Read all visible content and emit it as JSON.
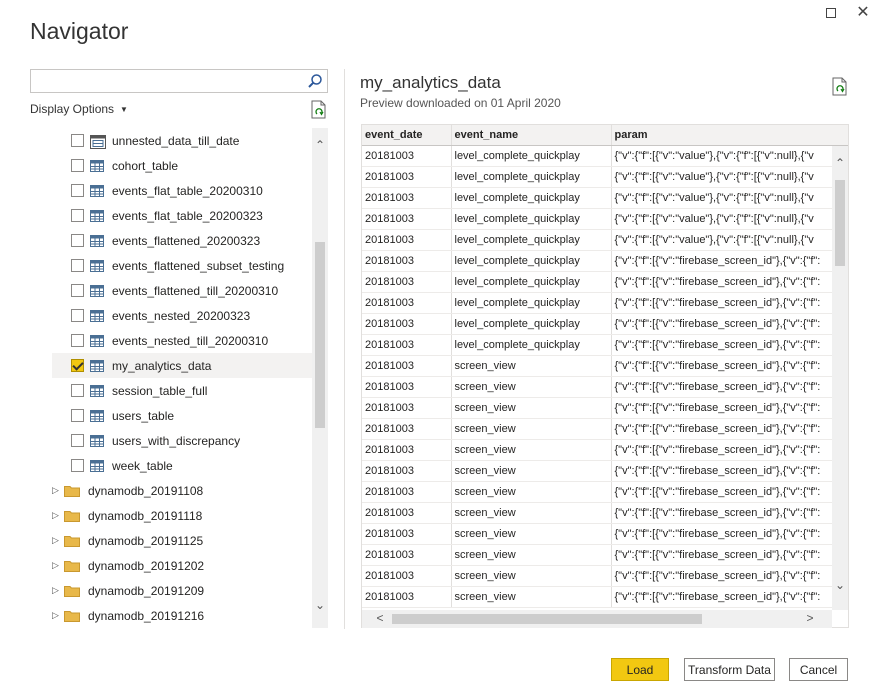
{
  "window": {
    "title": "Navigator"
  },
  "navigator": {
    "search": {
      "value": "",
      "placeholder": ""
    },
    "display_options_label": "Display Options",
    "items": [
      {
        "type": "view",
        "label": "unnested_data_till_date",
        "checked": false
      },
      {
        "type": "table",
        "label": "cohort_table",
        "checked": false
      },
      {
        "type": "table",
        "label": "events_flat_table_20200310",
        "checked": false
      },
      {
        "type": "table",
        "label": "events_flat_table_20200323",
        "checked": false
      },
      {
        "type": "table",
        "label": "events_flattened_20200323",
        "checked": false
      },
      {
        "type": "table",
        "label": "events_flattened_subset_testing",
        "checked": false
      },
      {
        "type": "table",
        "label": "events_flattened_till_20200310",
        "checked": false
      },
      {
        "type": "table",
        "label": "events_nested_20200323",
        "checked": false
      },
      {
        "type": "table",
        "label": "events_nested_till_20200310",
        "checked": false
      },
      {
        "type": "table",
        "label": "my_analytics_data",
        "checked": true
      },
      {
        "type": "table",
        "label": "session_table_full",
        "checked": false
      },
      {
        "type": "table",
        "label": "users_table",
        "checked": false
      },
      {
        "type": "table",
        "label": "users_with_discrepancy",
        "checked": false
      },
      {
        "type": "table",
        "label": "week_table",
        "checked": false
      },
      {
        "type": "folder",
        "label": "dynamodb_20191108"
      },
      {
        "type": "folder",
        "label": "dynamodb_20191118"
      },
      {
        "type": "folder",
        "label": "dynamodb_20191125"
      },
      {
        "type": "folder",
        "label": "dynamodb_20191202"
      },
      {
        "type": "folder",
        "label": "dynamodb_20191209"
      },
      {
        "type": "folder",
        "label": "dynamodb_20191216"
      }
    ]
  },
  "preview": {
    "title": "my_analytics_data",
    "subtitle": "Preview downloaded on 01 April 2020",
    "columns": [
      "event_date",
      "event_name",
      "param"
    ],
    "rows": [
      [
        "20181003",
        "level_complete_quickplay",
        "{\"v\":{\"f\":[{\"v\":\"value\"},{\"v\":{\"f\":[{\"v\":null},{\"v"
      ],
      [
        "20181003",
        "level_complete_quickplay",
        "{\"v\":{\"f\":[{\"v\":\"value\"},{\"v\":{\"f\":[{\"v\":null},{\"v"
      ],
      [
        "20181003",
        "level_complete_quickplay",
        "{\"v\":{\"f\":[{\"v\":\"value\"},{\"v\":{\"f\":[{\"v\":null},{\"v"
      ],
      [
        "20181003",
        "level_complete_quickplay",
        "{\"v\":{\"f\":[{\"v\":\"value\"},{\"v\":{\"f\":[{\"v\":null},{\"v"
      ],
      [
        "20181003",
        "level_complete_quickplay",
        "{\"v\":{\"f\":[{\"v\":\"value\"},{\"v\":{\"f\":[{\"v\":null},{\"v"
      ],
      [
        "20181003",
        "level_complete_quickplay",
        "{\"v\":{\"f\":[{\"v\":\"firebase_screen_id\"},{\"v\":{\"f\":"
      ],
      [
        "20181003",
        "level_complete_quickplay",
        "{\"v\":{\"f\":[{\"v\":\"firebase_screen_id\"},{\"v\":{\"f\":"
      ],
      [
        "20181003",
        "level_complete_quickplay",
        "{\"v\":{\"f\":[{\"v\":\"firebase_screen_id\"},{\"v\":{\"f\":"
      ],
      [
        "20181003",
        "level_complete_quickplay",
        "{\"v\":{\"f\":[{\"v\":\"firebase_screen_id\"},{\"v\":{\"f\":"
      ],
      [
        "20181003",
        "level_complete_quickplay",
        "{\"v\":{\"f\":[{\"v\":\"firebase_screen_id\"},{\"v\":{\"f\":"
      ],
      [
        "20181003",
        "screen_view",
        "{\"v\":{\"f\":[{\"v\":\"firebase_screen_id\"},{\"v\":{\"f\":"
      ],
      [
        "20181003",
        "screen_view",
        "{\"v\":{\"f\":[{\"v\":\"firebase_screen_id\"},{\"v\":{\"f\":"
      ],
      [
        "20181003",
        "screen_view",
        "{\"v\":{\"f\":[{\"v\":\"firebase_screen_id\"},{\"v\":{\"f\":"
      ],
      [
        "20181003",
        "screen_view",
        "{\"v\":{\"f\":[{\"v\":\"firebase_screen_id\"},{\"v\":{\"f\":"
      ],
      [
        "20181003",
        "screen_view",
        "{\"v\":{\"f\":[{\"v\":\"firebase_screen_id\"},{\"v\":{\"f\":"
      ],
      [
        "20181003",
        "screen_view",
        "{\"v\":{\"f\":[{\"v\":\"firebase_screen_id\"},{\"v\":{\"f\":"
      ],
      [
        "20181003",
        "screen_view",
        "{\"v\":{\"f\":[{\"v\":\"firebase_screen_id\"},{\"v\":{\"f\":"
      ],
      [
        "20181003",
        "screen_view",
        "{\"v\":{\"f\":[{\"v\":\"firebase_screen_id\"},{\"v\":{\"f\":"
      ],
      [
        "20181003",
        "screen_view",
        "{\"v\":{\"f\":[{\"v\":\"firebase_screen_id\"},{\"v\":{\"f\":"
      ],
      [
        "20181003",
        "screen_view",
        "{\"v\":{\"f\":[{\"v\":\"firebase_screen_id\"},{\"v\":{\"f\":"
      ],
      [
        "20181003",
        "screen_view",
        "{\"v\":{\"f\":[{\"v\":\"firebase_screen_id\"},{\"v\":{\"f\":"
      ],
      [
        "20181003",
        "screen_view",
        "{\"v\":{\"f\":[{\"v\":\"firebase_screen_id\"},{\"v\":{\"f\":"
      ]
    ]
  },
  "footer": {
    "load_label": "Load",
    "transform_label": "Transform Data",
    "cancel_label": "Cancel"
  },
  "colors": {
    "accent": "#f2c811",
    "folder": "#e8b84a",
    "table_icon": "#4a6f94"
  },
  "icons": {
    "search": "search-icon",
    "refresh": "refresh-icon",
    "table": "table-icon",
    "view": "view-icon",
    "folder": "folder-icon",
    "expand": "chevron-right-icon"
  }
}
